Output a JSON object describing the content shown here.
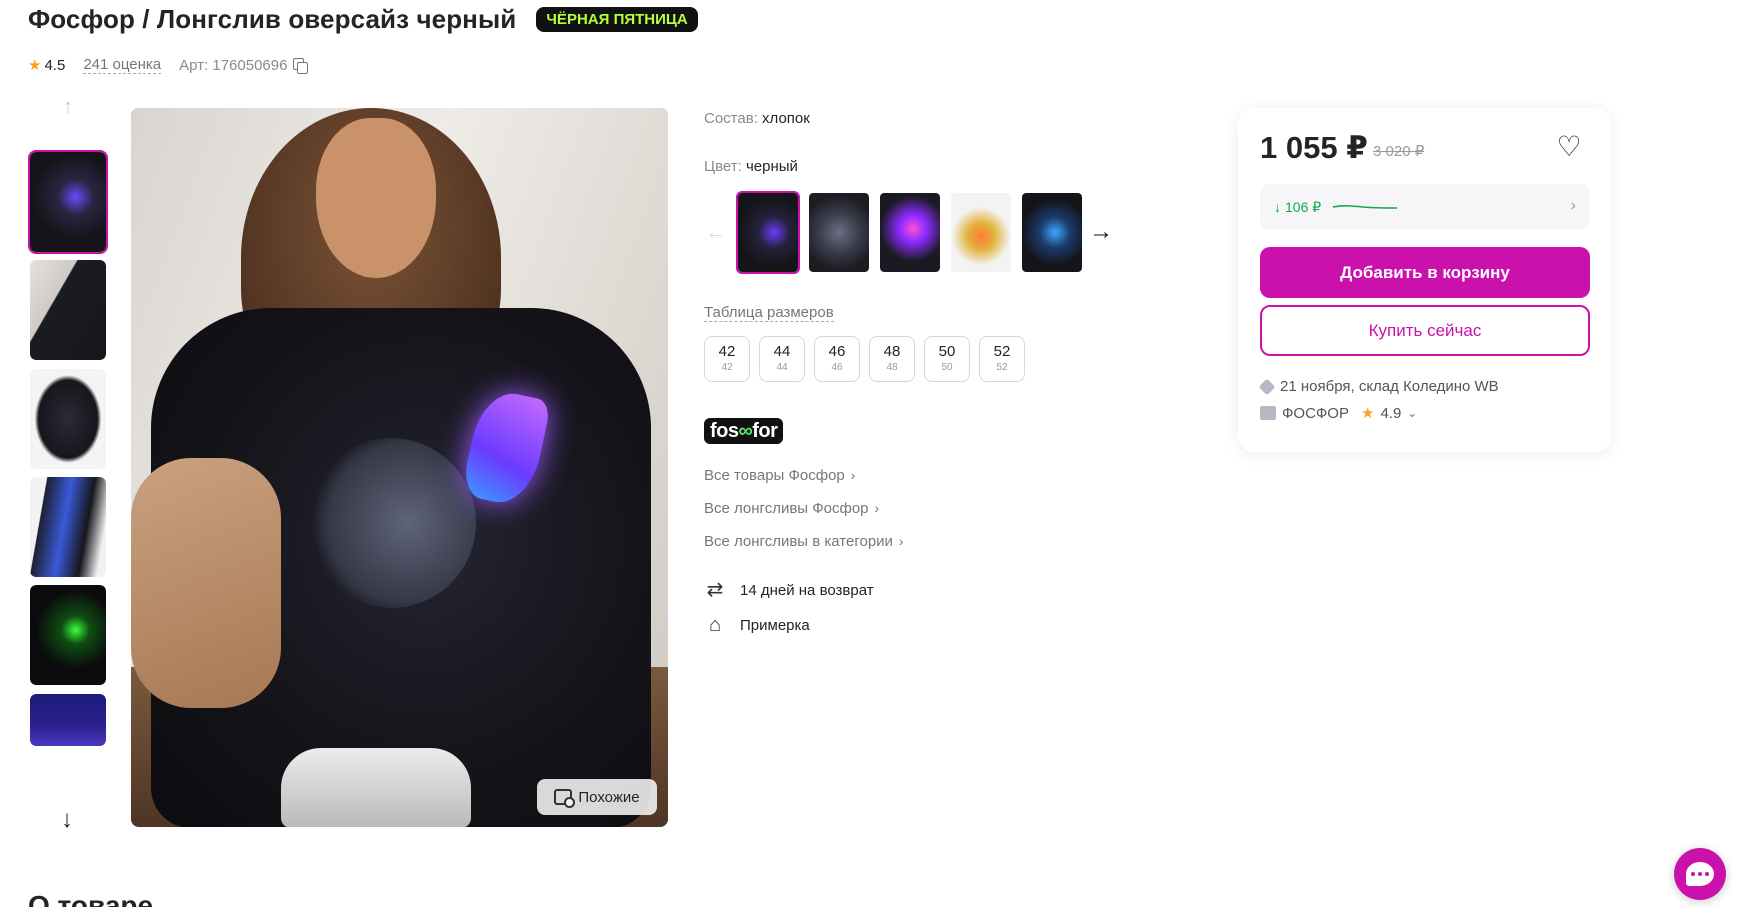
{
  "product": {
    "title": "Фосфор / Лонгслив оверсайз черный",
    "promo_badge": "ЧЁРНАЯ ПЯТНИЦА",
    "rating": "4.5",
    "reviews": "241 оценка",
    "article": "Арт: 176050696"
  },
  "gallery": {
    "thumbnails": [
      {
        "name": "thumb-1",
        "active": true
      },
      {
        "name": "thumb-2",
        "active": false
      },
      {
        "name": "thumb-3",
        "active": false
      },
      {
        "name": "thumb-4",
        "active": false
      },
      {
        "name": "thumb-5",
        "active": false
      },
      {
        "name": "thumb-6",
        "active": false
      }
    ],
    "similar_label": "Похожие"
  },
  "info": {
    "composition_label": "Состав:",
    "composition_value": "хлопок",
    "color_label": "Цвет:",
    "color_value": "черный",
    "size_table_label": "Таблица размеров",
    "sizes": [
      {
        "main": "42",
        "sub": "42"
      },
      {
        "main": "44",
        "sub": "44"
      },
      {
        "main": "46",
        "sub": "46"
      },
      {
        "main": "48",
        "sub": "48"
      },
      {
        "main": "50",
        "sub": "50"
      },
      {
        "main": "52",
        "sub": "52"
      }
    ],
    "brand_logo_left": "fos",
    "brand_logo_inf": "∞",
    "brand_logo_right": "for",
    "links": [
      "Все товары Фосфор",
      "Все лонгсливы Фосфор",
      "Все лонгсливы в категории"
    ],
    "return_label": "14 дней на возврат",
    "fitting_label": "Примерка"
  },
  "price_card": {
    "price": "1 055 ₽",
    "old_price": "3 020 ₽",
    "price_drop": "106 ₽",
    "add_to_cart": "Добавить в корзину",
    "buy_now": "Купить сейчас",
    "delivery": "21 ноября, склад Коледино WB",
    "seller": "ФОСФОР",
    "seller_rating": "4.9"
  },
  "section": {
    "about_title": "О товаре"
  },
  "colors": {
    "accent": "#cb11ab",
    "badge_bg": "#111111",
    "badge_text": "#b6ff3d",
    "price_drop": "#11a84e"
  },
  "icons": [
    "star-icon",
    "copy-icon",
    "arrow-up-icon",
    "arrow-down-icon",
    "arrow-left-icon",
    "arrow-right-icon",
    "search-similar-icon",
    "chevron-right-icon",
    "return-icon",
    "tag-icon",
    "heart-icon",
    "box-icon",
    "shop-icon",
    "chat-icon"
  ]
}
